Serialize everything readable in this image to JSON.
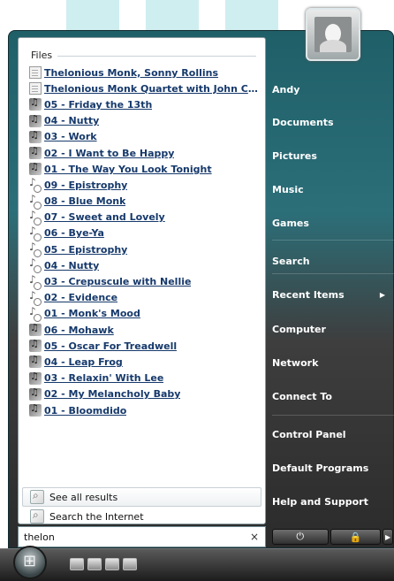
{
  "left_pane": {
    "group_header": "Files",
    "items": [
      {
        "label": "Thelonious Monk, Sonny Rollins",
        "icon": "document-icon"
      },
      {
        "label": "Thelonious Monk Quartet with John Co...",
        "icon": "document-icon"
      },
      {
        "label": "05 - Friday the 13th",
        "icon": "music-file-icon"
      },
      {
        "label": "04 - Nutty",
        "icon": "music-file-icon"
      },
      {
        "label": "03 - Work",
        "icon": "music-file-icon"
      },
      {
        "label": "02 - I Want to Be Happy",
        "icon": "music-file-icon"
      },
      {
        "label": "01 - The Way You Look Tonight",
        "icon": "music-file-icon"
      },
      {
        "label": "09 - Epistrophy",
        "icon": "audio-note-icon"
      },
      {
        "label": "08 - Blue Monk",
        "icon": "audio-note-icon"
      },
      {
        "label": "07 - Sweet and Lovely",
        "icon": "audio-note-icon"
      },
      {
        "label": "06 - Bye-Ya",
        "icon": "audio-note-icon"
      },
      {
        "label": "05 - Epistrophy",
        "icon": "audio-note-icon"
      },
      {
        "label": "04 - Nutty",
        "icon": "audio-note-icon"
      },
      {
        "label": "03 - Crepuscule with Nellie",
        "icon": "audio-note-icon"
      },
      {
        "label": "02 - Evidence",
        "icon": "audio-note-icon"
      },
      {
        "label": "01 - Monk's Mood",
        "icon": "audio-note-icon"
      },
      {
        "label": "06 - Mohawk",
        "icon": "music-file-icon"
      },
      {
        "label": "05 - Oscar For Treadwell",
        "icon": "music-file-icon"
      },
      {
        "label": "04 - Leap Frog",
        "icon": "music-file-icon"
      },
      {
        "label": "03 - Relaxin' With Lee",
        "icon": "music-file-icon"
      },
      {
        "label": "02 - My Melancholy Baby",
        "icon": "music-file-icon"
      },
      {
        "label": "01 - Bloomdido",
        "icon": "music-file-icon"
      }
    ],
    "see_all_label": "See all results",
    "search_internet_label": "Search the Internet"
  },
  "search": {
    "value": "thelon",
    "clear_glyph": "×"
  },
  "right_pane": {
    "items": [
      {
        "label": "Andy",
        "name": "right-item-andy"
      },
      {
        "label": "Documents",
        "name": "right-item-documents"
      },
      {
        "label": "Pictures",
        "name": "right-item-pictures"
      },
      {
        "label": "Music",
        "name": "right-item-music"
      },
      {
        "label": "Games",
        "name": "right-item-games"
      },
      {
        "label": "Search",
        "name": "right-item-search"
      },
      {
        "label": "Recent Items",
        "name": "right-item-recent-items",
        "arrow": "▶"
      },
      {
        "label": "Computer",
        "name": "right-item-computer"
      },
      {
        "label": "Network",
        "name": "right-item-network"
      },
      {
        "label": "Connect To",
        "name": "right-item-connect-to"
      },
      {
        "label": "Control Panel",
        "name": "right-item-control-panel"
      },
      {
        "label": "Default Programs",
        "name": "right-item-default-programs"
      },
      {
        "label": "Help and Support",
        "name": "right-item-help-and-support"
      }
    ]
  },
  "power": {
    "power_glyph": "⏻",
    "lock_glyph": "🔒",
    "more_glyph": "▶"
  },
  "colors": {
    "link_text": "#16396b",
    "menu_top": "#1f5f68",
    "menu_bottom": "#2b2b2b"
  }
}
